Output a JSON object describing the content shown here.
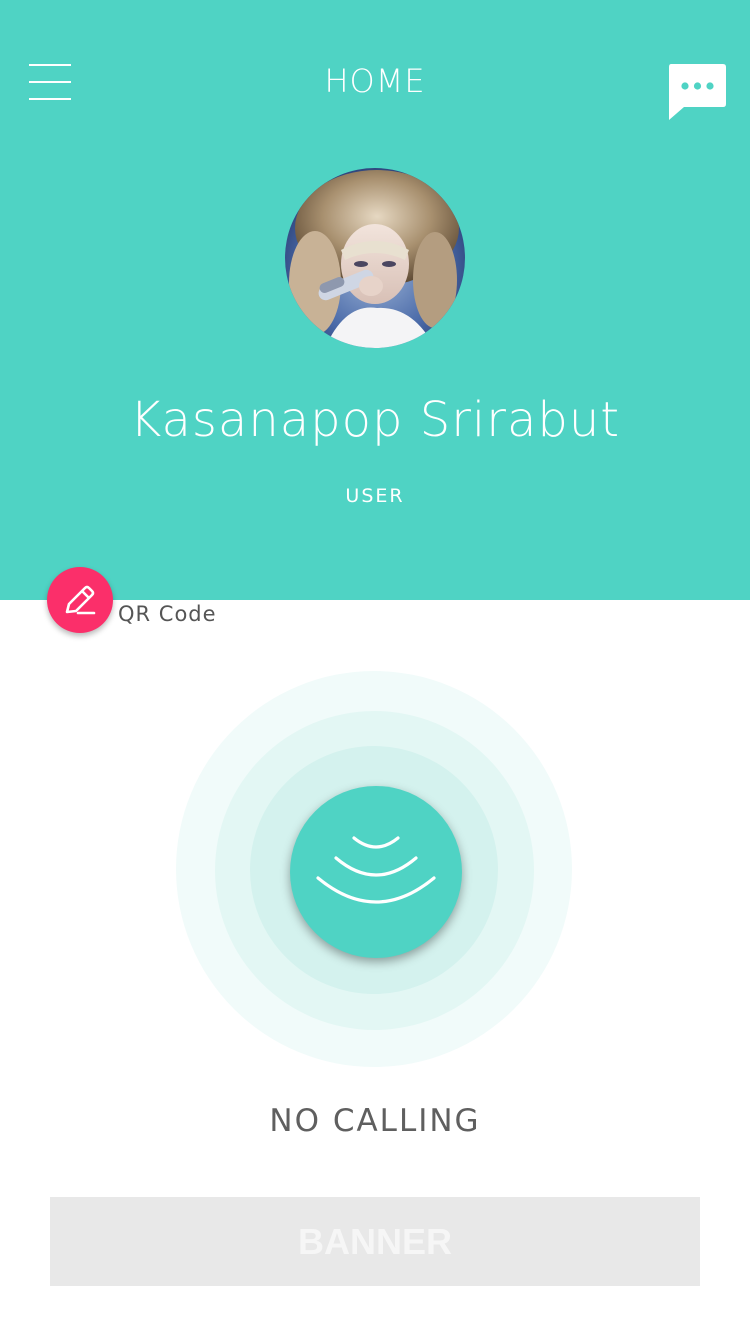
{
  "header": {
    "title": "HOME",
    "background_color": "#4fd3c4",
    "menu_icon": "hamburger-menu-icon",
    "chat_icon": "chat-bubble-icon"
  },
  "profile": {
    "name": "Kasanapop Srirabut",
    "role": "USER",
    "avatar_icon": "user-avatar-photo"
  },
  "qr": {
    "label": "QR Code",
    "fab_color": "#fb2f6a",
    "fab_icon": "pencil-icon"
  },
  "call": {
    "status": "NO CALLING",
    "button_icon": "signal-waves-icon"
  },
  "banner": {
    "label": "BANNER"
  }
}
